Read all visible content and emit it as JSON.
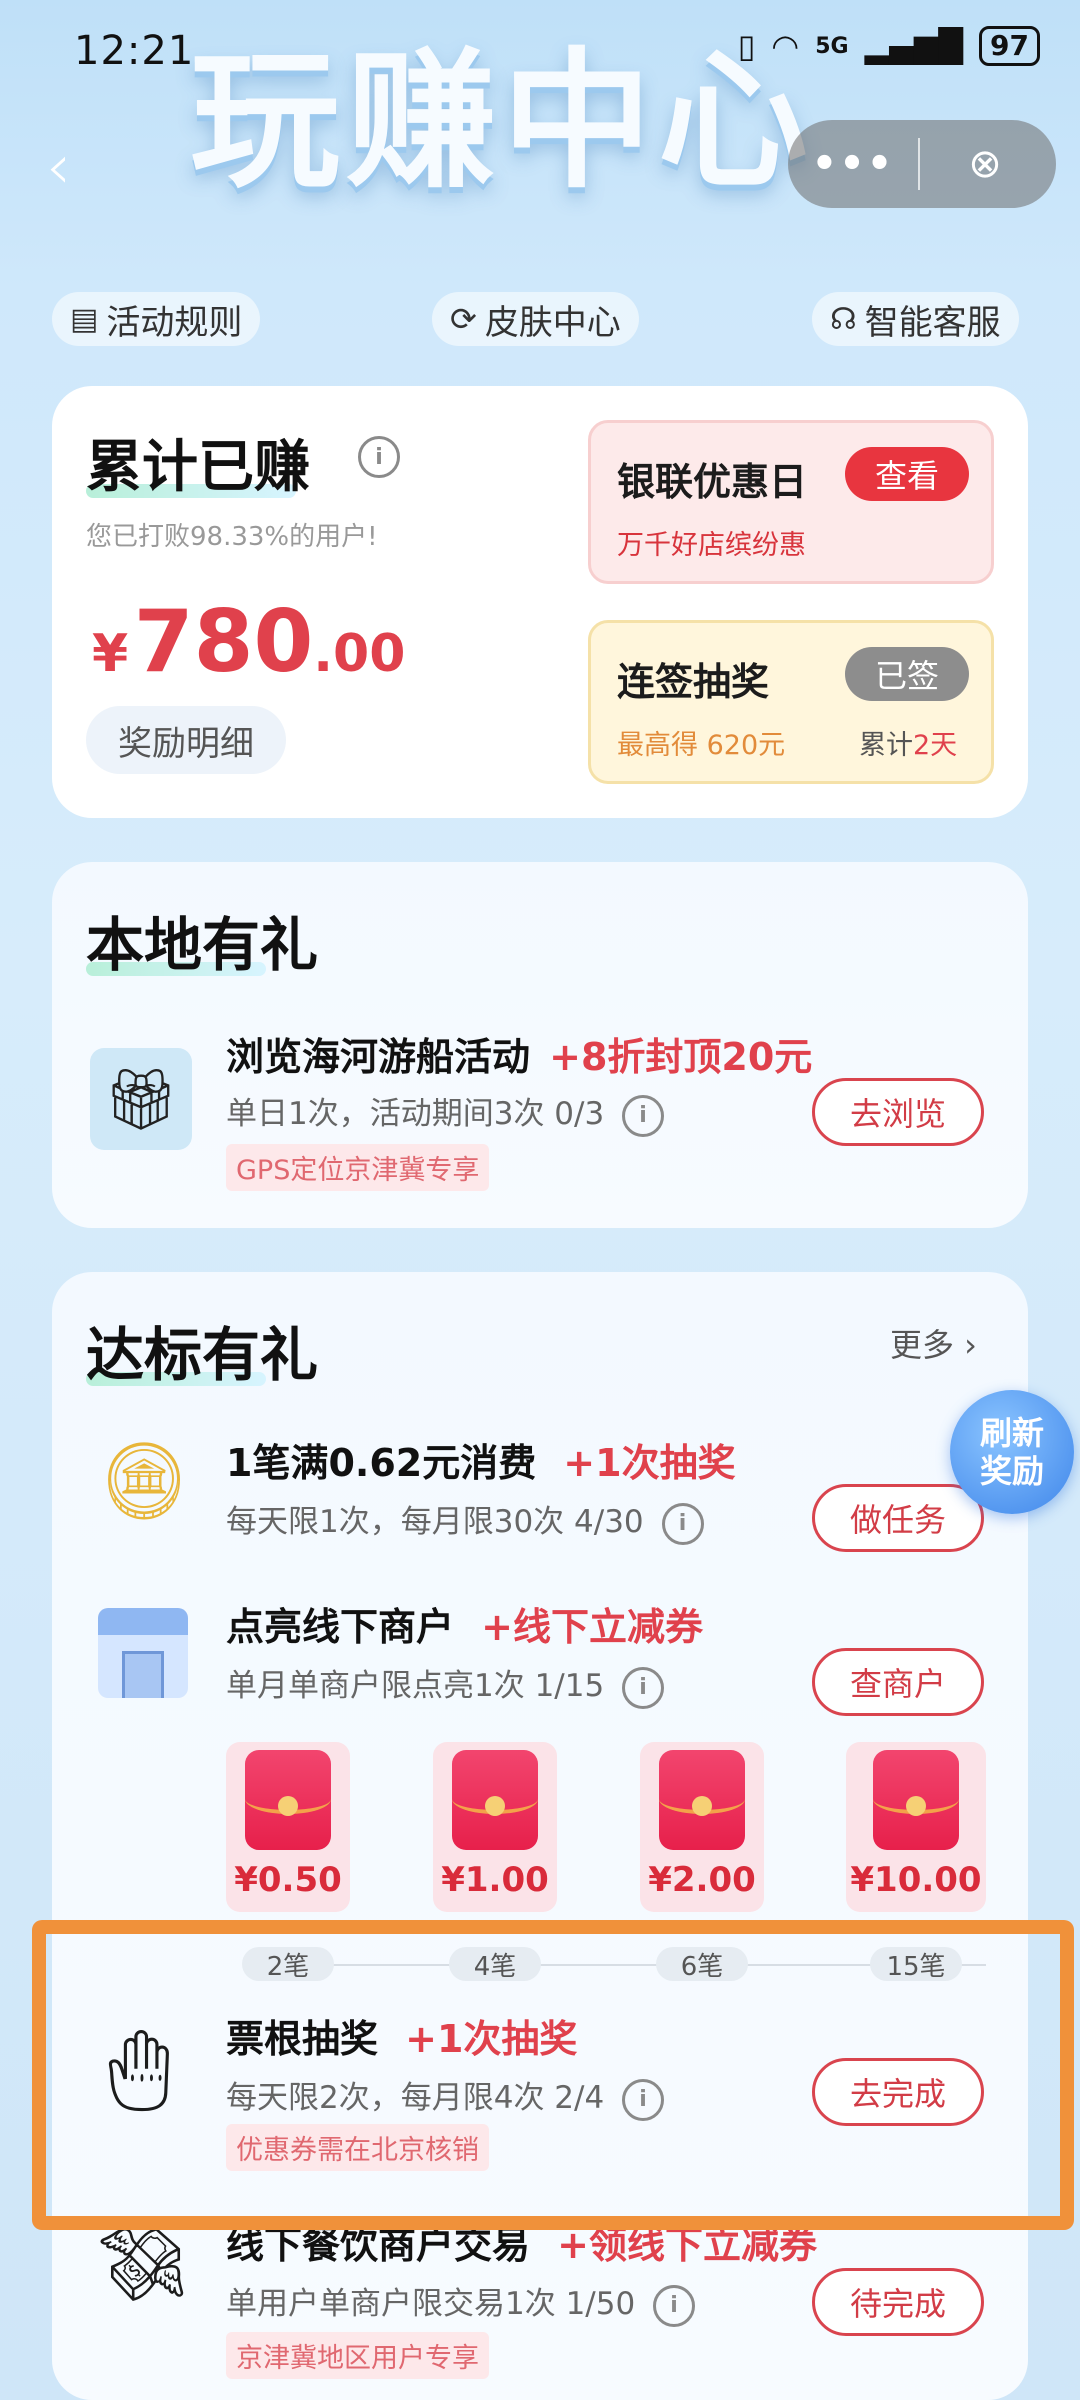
{
  "status_bar": {
    "time": "12:21",
    "network": "5G",
    "battery": "97"
  },
  "hero": {
    "title": "玩赚中心"
  },
  "nav": {
    "more": "•••",
    "close": "⊗"
  },
  "top_links": [
    {
      "label": "活动规则",
      "icon": "document-icon"
    },
    {
      "label": "皮肤中心",
      "icon": "refresh-icon"
    },
    {
      "label": "智能客服",
      "icon": "headset-icon"
    }
  ],
  "earnings": {
    "title": "累计已赚",
    "subtitle": "您已打败98.33%的用户!",
    "currency": "¥",
    "amount_int": "780",
    "amount_dec": ".00",
    "detail_button": "奖励明细"
  },
  "unionpay_day": {
    "title": "银联优惠日",
    "button": "查看",
    "subtitle": "万千好店缤纷惠"
  },
  "checkin_lottery": {
    "title": "连签抽奖",
    "button": "已签",
    "max_prefix": "最高得",
    "max_value": "620元",
    "streak_prefix": "累计",
    "streak_value": "2天"
  },
  "local_gifts": {
    "title": "本地有礼",
    "task": {
      "title": "浏览海河游船活动",
      "bonus": "+8折封顶20元",
      "sub": "单日1次，活动期间3次 0/3",
      "tag": "GPS定位京津冀专享",
      "button": "去浏览"
    }
  },
  "target_gifts": {
    "title": "达标有礼",
    "more": "更多 ›",
    "refresh_badge_line1": "刷新",
    "refresh_badge_line2": "奖励",
    "tasks": [
      {
        "title": "1笔满0.62元消费",
        "bonus": "+1次抽奖",
        "sub": "每天限1次，每月限30次 4/30",
        "button": "做任务"
      },
      {
        "title": "点亮线下商户",
        "bonus": "+线下立减券",
        "sub": "单月单商户限点亮1次 1/15",
        "button": "查商户"
      },
      {
        "title": "票根抽奖",
        "bonus": "+1次抽奖",
        "sub": "每天限2次，每月限4次 2/4",
        "tag": "优惠券需在北京核销",
        "button": "去完成"
      },
      {
        "title": "线下餐饮商户交易",
        "bonus": "+领线下立减券",
        "sub": "单用户单商户限交易1次 1/50",
        "tag": "京津冀地区用户专享",
        "button": "待完成"
      }
    ],
    "red_packets": [
      {
        "value": "¥0.50",
        "step": "2笔"
      },
      {
        "value": "¥1.00",
        "step": "4笔"
      },
      {
        "value": "¥2.00",
        "step": "6笔"
      },
      {
        "value": "¥10.00",
        "step": "15笔"
      }
    ]
  },
  "colors": {
    "accent_red": "#e0414c",
    "highlight_orange": "#f0913a"
  }
}
